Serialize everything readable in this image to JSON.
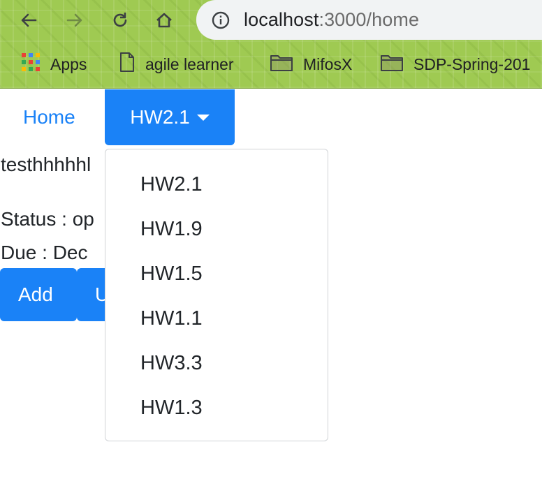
{
  "browser": {
    "url_host": "localhost",
    "url_rest": ":3000/home",
    "bookmarks": [
      {
        "label": "Apps",
        "icon": "apps-grid-icon"
      },
      {
        "label": "agile learner",
        "icon": "page-icon"
      },
      {
        "label": "MifosX",
        "icon": "folder-icon"
      },
      {
        "label": "SDP-Spring-201",
        "icon": "folder-icon"
      }
    ]
  },
  "nav": {
    "home_label": "Home",
    "dropdown_label": "HW2.1"
  },
  "content": {
    "title": "testhhhhhl",
    "status": "Status : op",
    "due": "Due : Dec",
    "add_label": "Add",
    "second_button_label": "U"
  },
  "menu": {
    "items": [
      "HW2.1",
      "HW1.9",
      "HW1.5",
      "HW1.1",
      "HW3.3",
      "HW1.3"
    ]
  },
  "colors": {
    "primary": "#1a82f7",
    "chrome_green": "#9fca52"
  }
}
